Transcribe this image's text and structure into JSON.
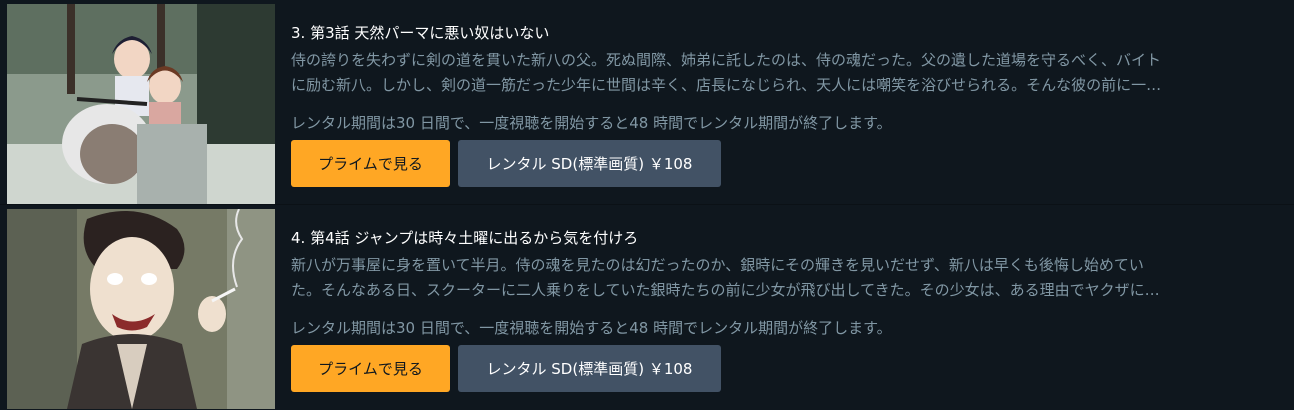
{
  "episodes": [
    {
      "title": "3. 第3話 天然パーマに悪い奴はいない",
      "synopsis_line1": "侍の誇りを失わずに剣の道を貫いた新八の父。死ぬ間際、姉弟に託したのは、侍の魂だった。父の遺した道場を守るべく、バイト",
      "synopsis_line2": "に励む新八。しかし、剣の道一筋だった少年に世間は辛く、店長になじられ、天人には嘲笑を浴びせられる。そんな彼の前に一…",
      "rental_note": "レンタル期間は30 日間で、一度視聴を開始すると48 時間でレンタル期間が終了します。",
      "prime_label": "プライムで見る",
      "rent_label": "レンタル SD(標準画質) ￥108"
    },
    {
      "title": "4. 第4話 ジャンプは時々土曜に出るから気を付けろ",
      "synopsis_line1": "新八が万事屋に身を置いて半月。侍の魂を見たのは幻だったのか、銀時にその輝きを見いだせず、新八は早くも後悔し始めてい",
      "synopsis_line2": "た。そんなある日、スクーターに二人乗りをしていた銀時たちの前に少女が飛び出してきた。その少女は、ある理由でヤクザに…",
      "rental_note": "レンタル期間は30 日間で、一度視聴を開始すると48 時間でレンタル期間が終了します。",
      "prime_label": "プライムで見る",
      "rent_label": "レンタル SD(標準画質) ￥108"
    }
  ],
  "colors": {
    "background": "#0f171e",
    "prime_button": "#ffa724",
    "rent_button": "#425265",
    "muted_text": "#8197a4"
  }
}
